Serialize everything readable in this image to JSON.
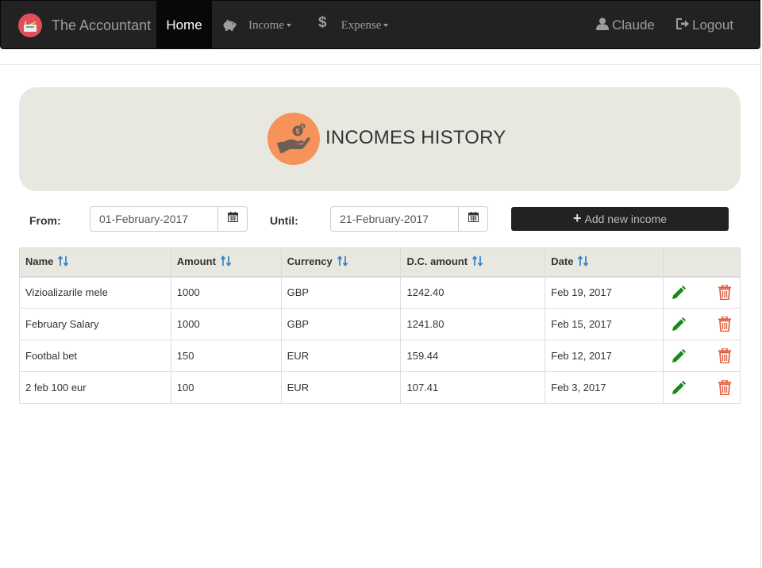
{
  "navbar": {
    "brand": "The Accountant",
    "home": "Home",
    "income": "Income",
    "expense": "Expense",
    "user": "Claude",
    "logout": "Logout"
  },
  "header": {
    "title": "INCOMES HISTORY",
    "icon": "money-hand-icon"
  },
  "filters": {
    "from_label": "From:",
    "from_value": "01-February-2017",
    "until_label": "Until:",
    "until_value": "21-February-2017",
    "add_button": "Add new income"
  },
  "table": {
    "columns": [
      "Name",
      "Amount",
      "Currency",
      "D.C. amount",
      "Date"
    ],
    "rows": [
      {
        "name": "Vizioalizarile mele",
        "amount": "1000",
        "currency": "GBP",
        "dc_amount": "1242.40",
        "date": "Feb 19, 2017"
      },
      {
        "name": "February Salary",
        "amount": "1000",
        "currency": "GBP",
        "dc_amount": "1241.80",
        "date": "Feb 15, 2017"
      },
      {
        "name": "Footbal bet",
        "amount": "150",
        "currency": "EUR",
        "dc_amount": "159.44",
        "date": "Feb 12, 2017"
      },
      {
        "name": "2 feb 100 eur",
        "amount": "100",
        "currency": "EUR",
        "dc_amount": "107.41",
        "date": "Feb 3, 2017"
      }
    ]
  },
  "colors": {
    "navbar": "#222222",
    "panel": "#e9e8e0",
    "accent_orange": "#f5935a",
    "edit_green": "#1a8a1a",
    "delete_red": "#e0583a",
    "sort_blue": "#3a87c7"
  }
}
